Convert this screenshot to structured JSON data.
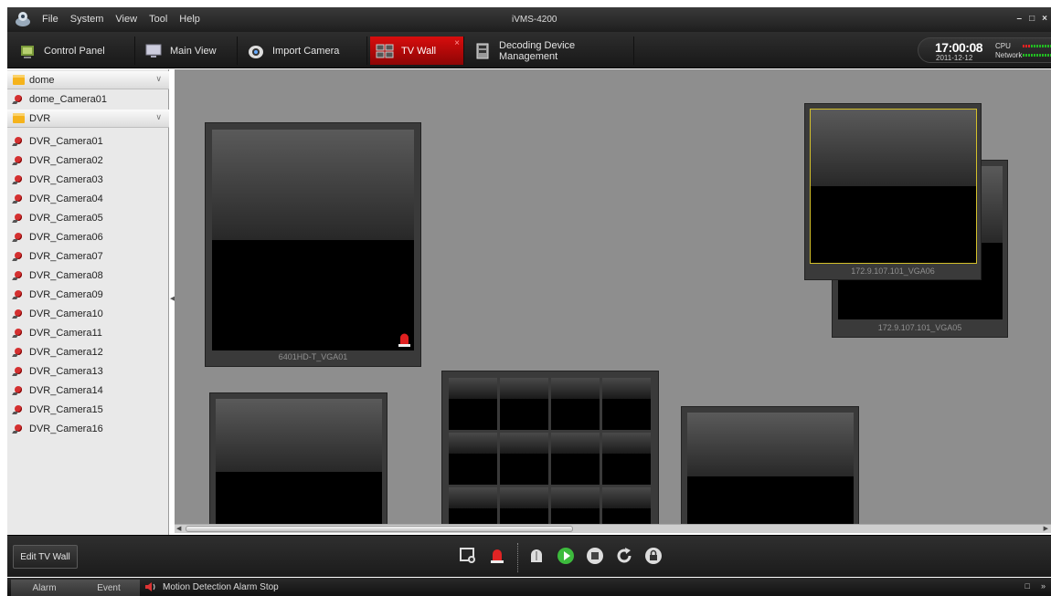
{
  "window": {
    "title": "iVMS-4200",
    "menu": [
      "File",
      "System",
      "View",
      "Tool",
      "Help"
    ],
    "controls": {
      "minimize": "–",
      "maximize": "□",
      "close": "×"
    }
  },
  "tabs": [
    {
      "label": "Control Panel",
      "icon": "control-panel-icon"
    },
    {
      "label": "Main View",
      "icon": "monitor-icon"
    },
    {
      "label": "Import Camera",
      "icon": "camera-import-icon"
    },
    {
      "label": "TV Wall",
      "icon": "tv-wall-icon",
      "active": true,
      "close": "×"
    },
    {
      "label": "Decoding Device Management",
      "icon": "decoder-icon"
    }
  ],
  "status": {
    "time": "17:00:08",
    "date": "2011-12-12",
    "cpu_label": "CPU",
    "network_label": "Network"
  },
  "sidebar": {
    "items": [
      {
        "label": "dome",
        "type": "group"
      },
      {
        "label": "dome_Camera01",
        "type": "camera"
      },
      {
        "label": "DVR",
        "type": "group"
      },
      {
        "label": "DVR_Camera01",
        "type": "camera"
      },
      {
        "label": "DVR_Camera02",
        "type": "camera"
      },
      {
        "label": "DVR_Camera03",
        "type": "camera"
      },
      {
        "label": "DVR_Camera04",
        "type": "camera"
      },
      {
        "label": "DVR_Camera05",
        "type": "camera"
      },
      {
        "label": "DVR_Camera06",
        "type": "camera"
      },
      {
        "label": "DVR_Camera07",
        "type": "camera"
      },
      {
        "label": "DVR_Camera08",
        "type": "camera"
      },
      {
        "label": "DVR_Camera09",
        "type": "camera"
      },
      {
        "label": "DVR_Camera10",
        "type": "camera"
      },
      {
        "label": "DVR_Camera11",
        "type": "camera"
      },
      {
        "label": "DVR_Camera12",
        "type": "camera"
      },
      {
        "label": "DVR_Camera13",
        "type": "camera"
      },
      {
        "label": "DVR_Camera14",
        "type": "camera"
      },
      {
        "label": "DVR_Camera15",
        "type": "camera"
      },
      {
        "label": "DVR_Camera16",
        "type": "camera"
      }
    ]
  },
  "tv_wall": {
    "screens": [
      {
        "label": "6401HD-T_VGA01",
        "alarm": true
      },
      {
        "label": "172.9.107.101_VGA05"
      },
      {
        "label": "172.9.107.101_VGA06",
        "selected": true
      },
      {
        "label": ""
      },
      {
        "label": "",
        "split": "4x3"
      },
      {
        "label": ""
      }
    ]
  },
  "toolbar": {
    "edit_button": "Edit TV Wall",
    "tools": [
      "screen-capture-icon",
      "alarm-icon",
      "decode-icon",
      "play-icon",
      "stop-icon",
      "refresh-icon",
      "lock-icon"
    ]
  },
  "statusbar": {
    "tabs": [
      "Alarm",
      "Event"
    ],
    "message": "Motion Detection Alarm  Stop",
    "right": [
      "□",
      "»"
    ]
  },
  "colors": {
    "accent": "#c80a0a",
    "selected_outline": "#d4c02a"
  }
}
